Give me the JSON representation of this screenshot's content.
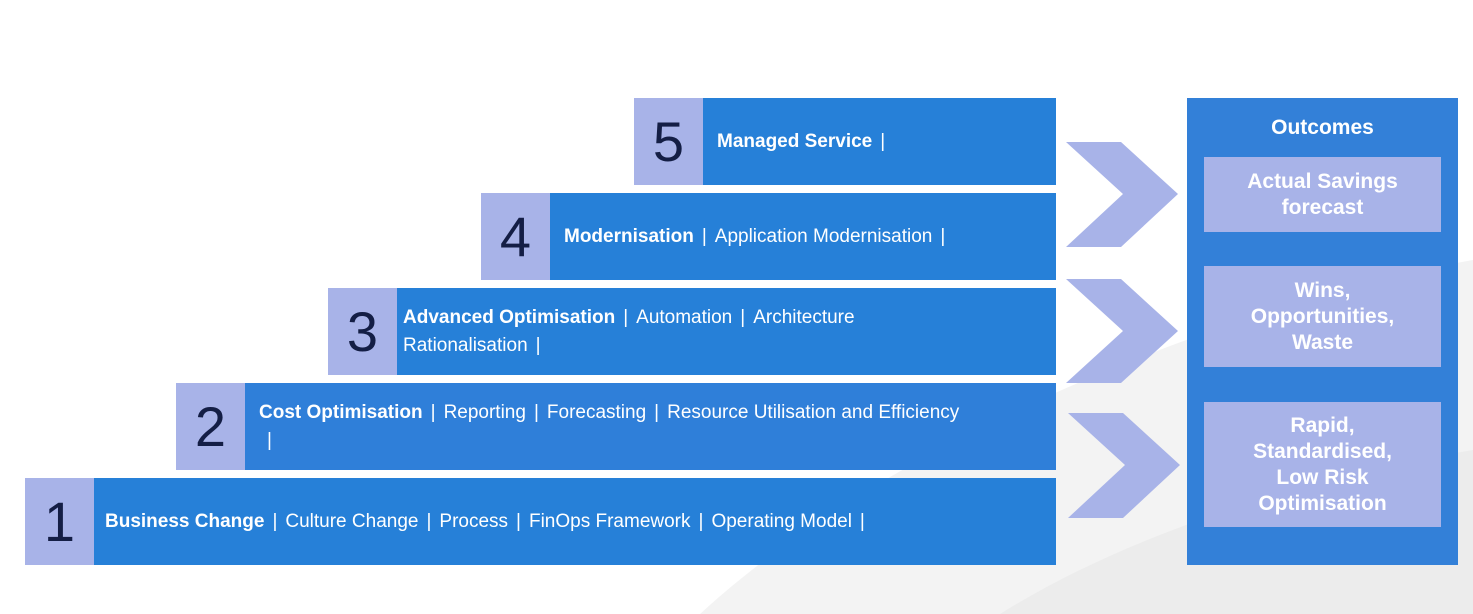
{
  "steps": [
    {
      "number": "5",
      "title": "Managed Service",
      "items": []
    },
    {
      "number": "4",
      "title": "Modernisation",
      "items": [
        "Application Modernisation"
      ]
    },
    {
      "number": "3",
      "title": "Advanced Optimisation",
      "items": [
        "Automation",
        "Architecture Rationalisation"
      ]
    },
    {
      "number": "2",
      "title": "Cost Optimisation",
      "items": [
        "Reporting",
        "Forecasting",
        "Resource Utilisation and Efficiency"
      ]
    },
    {
      "number": "1",
      "title": "Business Change",
      "items": [
        "Culture Change",
        "Process",
        "FinOps Framework",
        "Operating Model"
      ]
    }
  ],
  "separator": "|",
  "outcomes": {
    "title": "Outcomes",
    "cards": [
      "Actual Savings forecast",
      "Wins, Opportunities, Waste",
      "Rapid, Standardised, Low Risk Optimisation"
    ]
  },
  "colors": {
    "bar": "#2680d8",
    "number_box": "#a8b3e8",
    "number_text": "#141e45",
    "panel": "#3380d8"
  }
}
